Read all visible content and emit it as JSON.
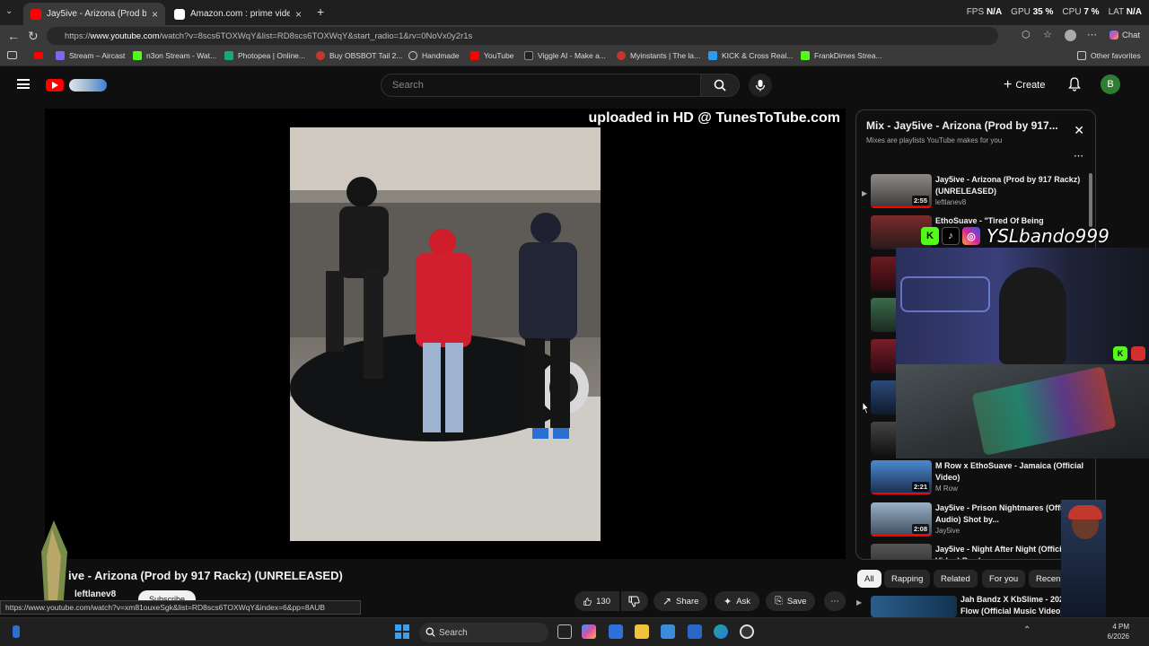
{
  "tabs": [
    {
      "label": "Jay5ive - Arizona (Prod by 917",
      "close": "×"
    },
    {
      "label": "Amazon.com : prime video",
      "close": "×"
    }
  ],
  "new_tab": "+",
  "perf": {
    "fps_label": "FPS",
    "fps": "N/A",
    "gpu_label": "GPU",
    "gpu": "35 %",
    "cpu_label": "CPU",
    "cpu": "7 %",
    "lat_label": "LAT",
    "lat": "N/A"
  },
  "url": {
    "scheme": "https://",
    "host": "www.youtube.com",
    "path": "/watch?v=8scs6TOXWqY&list=RD8scs6TOXWqY&start_radio=1&rv=0NoVx0y2r1s"
  },
  "chat_label": "Chat",
  "bookmarks": [
    "Stream – Aircast",
    "n3on Stream - Wat...",
    "Photopea | Online...",
    "Buy OBSBOT Tail 2...",
    "Handmade",
    "YouTube",
    "Viggle AI - Make a...",
    "Myinstants | The la...",
    "KICK & Cross Real...",
    "FrankDimes Strea..."
  ],
  "other_favorites": "Other favorites",
  "search": {
    "placeholder": "Search"
  },
  "create_label": "Create",
  "avatar_letter": "B",
  "player": {
    "watermark": "uploaded in HD @ TunesToTube.com"
  },
  "video": {
    "title": "ive - Arizona (Prod by 917 Rackz) (UNRELEASED)",
    "channel": "leftlanev8",
    "subscribe": "Subscribe",
    "likes": "130",
    "share": "Share",
    "ask": "Ask",
    "save": "Save"
  },
  "status_url": "https://www.youtube.com/watch?v=xm81ouxeSgk&list=RD8scs6TOXWqY&index=6&pp=8AUB",
  "panel": {
    "title": "Mix - Jay5ive - Arizona (Prod by 917...",
    "subtitle": "Mixes are playlists YouTube makes for you",
    "items": [
      {
        "title": "Jay5ive - Arizona (Prod by 917 Rackz) (UNRELEASED)",
        "channel": "leftlanev8",
        "duration": "2:55"
      },
      {
        "title": "EthoSuave - \"Tired Of Being",
        "channel": "",
        "duration": ""
      },
      {
        "title": "M Row x EthoSuave - Jamaica (Official Video)",
        "channel": "M Row",
        "duration": "2:21"
      },
      {
        "title": "Jay5ive - Prison Nightmares (Official Audio) Shot by...",
        "channel": "Jay5ive",
        "duration": "2:08"
      },
      {
        "title": "Jay5ive - Night After Night (Official Video) Prod...",
        "channel": "",
        "duration": ""
      }
    ]
  },
  "overlay": {
    "name": "YSLbando999"
  },
  "chips": [
    "All",
    "Rapping",
    "Related",
    "For you",
    "Recen"
  ],
  "next_video": {
    "title": "Jah Bandz X KbSlime - 202 Flow (Official Music Video)"
  },
  "taskbar": {
    "search": "Search",
    "time": "4 PM",
    "date": "6/2026"
  },
  "colors": {
    "accent_red": "#ff0000",
    "kick_green": "#53fc18",
    "bg": "#0f0f0f"
  }
}
